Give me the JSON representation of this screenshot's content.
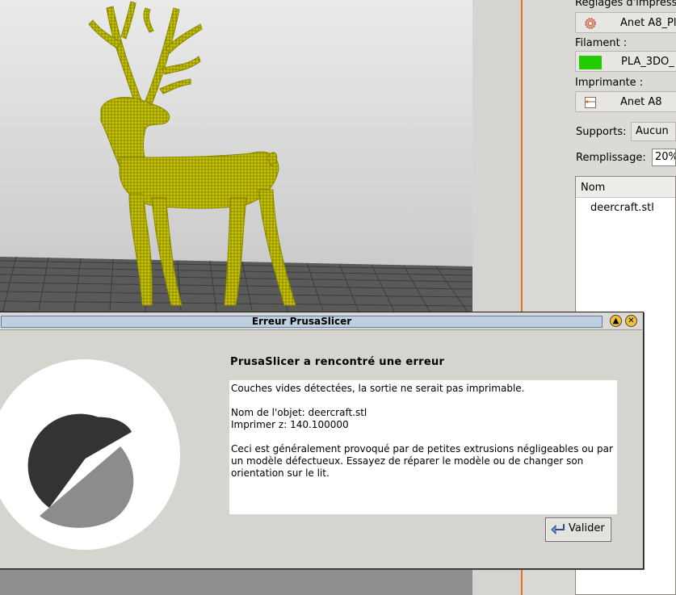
{
  "sidebar": {
    "print_settings_label": "Réglages d'impress",
    "print_settings_value": "Anet A8_Pl",
    "filament_label": "Filament :",
    "filament_value": "PLA_3DO_",
    "filament_color": "#22cc00",
    "printer_label": "Imprimante :",
    "printer_value": "Anet A8",
    "supports_label": "Supports:",
    "supports_value": "Aucun",
    "infill_label": "Remplissage:",
    "infill_value": "20%",
    "object_list_header": "Nom",
    "objects": [
      "deercraft.stl"
    ]
  },
  "dialog": {
    "title": "Erreur PrusaSlicer",
    "heading": "PrusaSlicer a rencontré une erreur",
    "message_line1": "Couches vides détectées, la sortie ne serait pas imprimable.",
    "message_object": "Nom de l'objet: deercraft.stl",
    "message_z": "Imprimer z: 140.100000",
    "message_hint": "Ceci est généralement provoqué par de petites extrusions négligeables ou par un modèle défectueux. Essayez de réparer le modèle ou de changer son orientation sur le lit.",
    "ok_label": "Valider"
  },
  "colors": {
    "accent_orange": "#f26d21",
    "model_yellow": "#c9c400"
  },
  "icons": {
    "print_settings": "cog-icon",
    "printer": "printer-icon",
    "ok": "return-arrow-icon"
  }
}
